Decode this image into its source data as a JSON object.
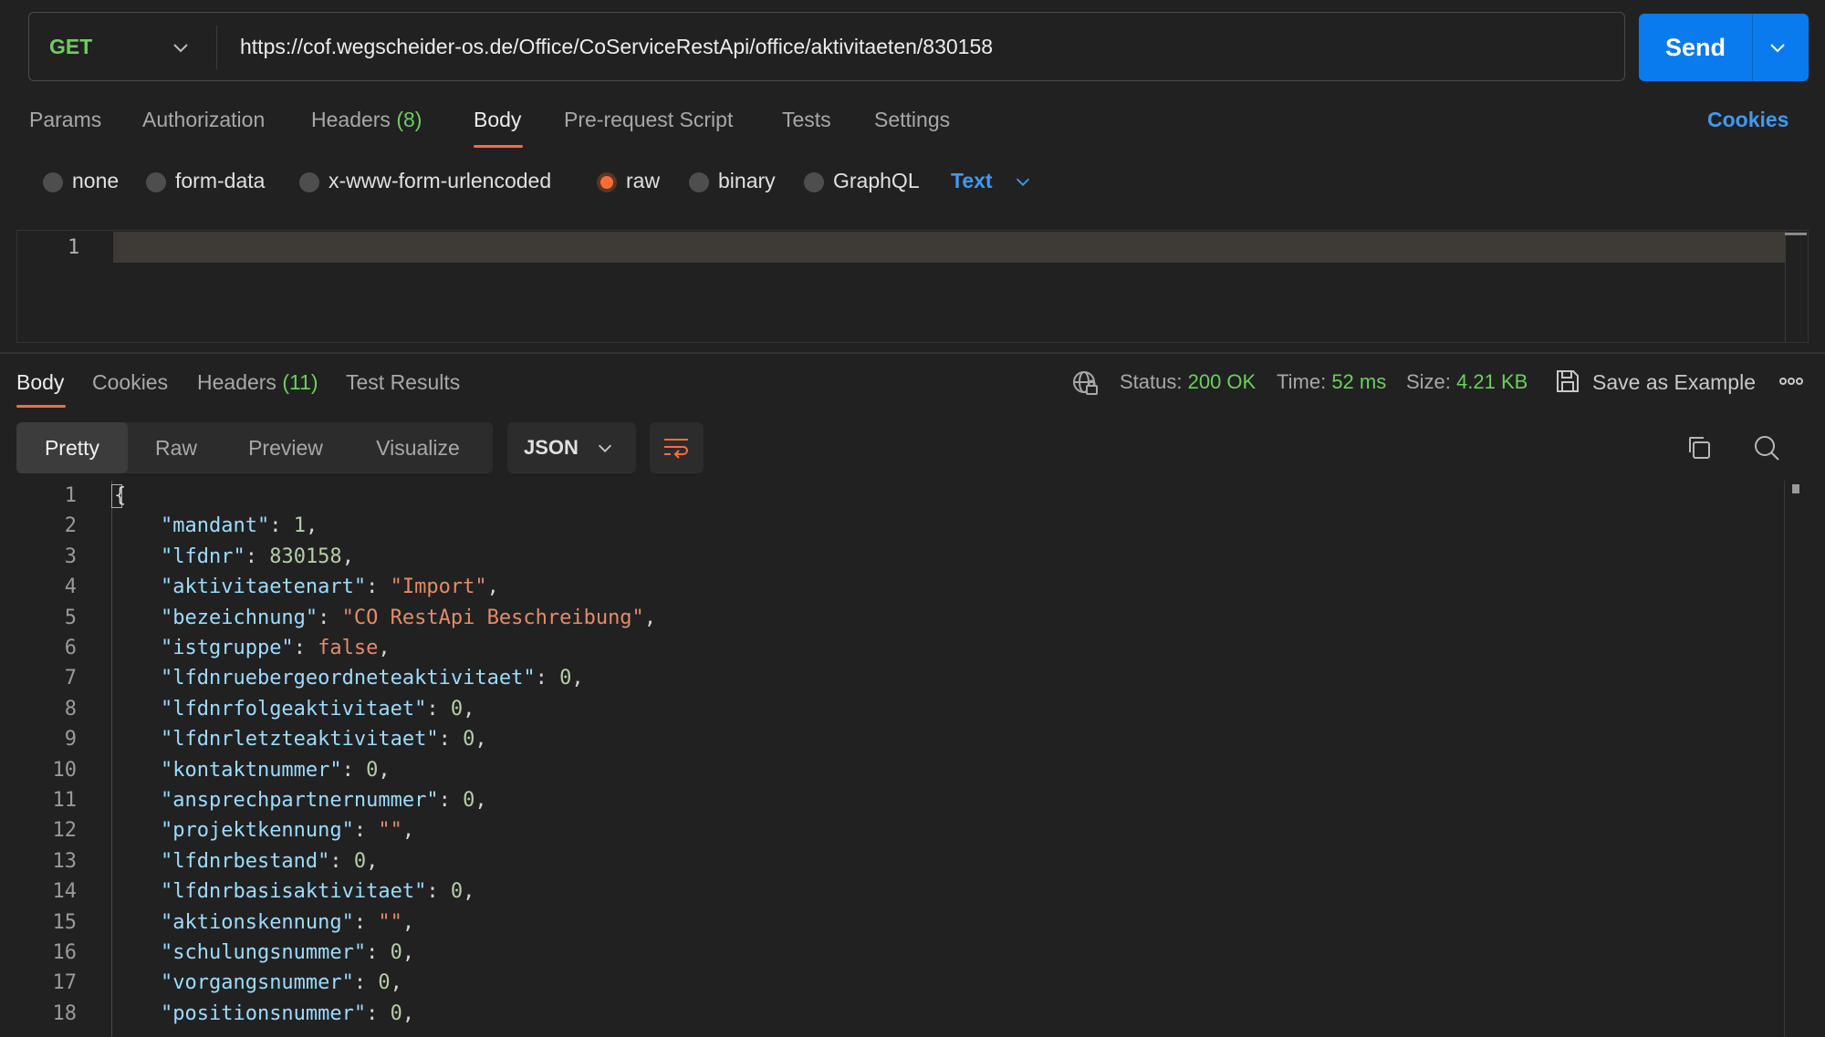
{
  "request": {
    "method": "GET",
    "url": "https://cof.wegscheider-os.de/Office/CoServiceRestApi/office/aktivitaeten/830158",
    "send_label": "Send"
  },
  "request_tabs": {
    "params": "Params",
    "authorization": "Authorization",
    "headers": "Headers",
    "headers_count": "(8)",
    "body": "Body",
    "pre_request_script": "Pre-request Script",
    "tests": "Tests",
    "settings": "Settings",
    "cookies": "Cookies"
  },
  "body_types": {
    "none": "none",
    "form_data": "form-data",
    "urlencoded": "x-www-form-urlencoded",
    "raw": "raw",
    "binary": "binary",
    "graphql": "GraphQL",
    "selected": "raw",
    "raw_format": "Text"
  },
  "request_editor": {
    "line_number": "1"
  },
  "response_tabs": {
    "body": "Body",
    "cookies": "Cookies",
    "headers": "Headers",
    "headers_count": "(11)",
    "test_results": "Test Results"
  },
  "response_meta": {
    "status_label": "Status:",
    "status_value": "200 OK",
    "time_label": "Time:",
    "time_value": "52 ms",
    "size_label": "Size:",
    "size_value": "4.21 KB",
    "save_as_example": "Save as Example"
  },
  "view_modes": {
    "pretty": "Pretty",
    "raw": "Raw",
    "preview": "Preview",
    "visualize": "Visualize",
    "format": "JSON"
  },
  "response_body": {
    "lines": [
      {
        "n": "1",
        "open": "{"
      },
      {
        "n": "2",
        "key": "\"mandant\"",
        "value": "1",
        "type": "num"
      },
      {
        "n": "3",
        "key": "\"lfdnr\"",
        "value": "830158",
        "type": "num"
      },
      {
        "n": "4",
        "key": "\"aktivitaetenart\"",
        "value": "\"Import\"",
        "type": "str"
      },
      {
        "n": "5",
        "key": "\"bezeichnung\"",
        "value": "\"CO RestApi Beschreibung\"",
        "type": "str"
      },
      {
        "n": "6",
        "key": "\"istgruppe\"",
        "value": "false",
        "type": "bool"
      },
      {
        "n": "7",
        "key": "\"lfdnruebergeordneteaktivitaet\"",
        "value": "0",
        "type": "num"
      },
      {
        "n": "8",
        "key": "\"lfdnrfolgeaktivitaet\"",
        "value": "0",
        "type": "num"
      },
      {
        "n": "9",
        "key": "\"lfdnrletzteaktivitaet\"",
        "value": "0",
        "type": "num"
      },
      {
        "n": "10",
        "key": "\"kontaktnummer\"",
        "value": "0",
        "type": "num"
      },
      {
        "n": "11",
        "key": "\"ansprechpartnernummer\"",
        "value": "0",
        "type": "num"
      },
      {
        "n": "12",
        "key": "\"projektkennung\"",
        "value": "\"\"",
        "type": "str"
      },
      {
        "n": "13",
        "key": "\"lfdnrbestand\"",
        "value": "0",
        "type": "num"
      },
      {
        "n": "14",
        "key": "\"lfdnrbasisaktivitaet\"",
        "value": "0",
        "type": "num"
      },
      {
        "n": "15",
        "key": "\"aktionskennung\"",
        "value": "\"\"",
        "type": "str"
      },
      {
        "n": "16",
        "key": "\"schulungsnummer\"",
        "value": "0",
        "type": "num"
      },
      {
        "n": "17",
        "key": "\"vorgangsnummer\"",
        "value": "0",
        "type": "num"
      },
      {
        "n": "18",
        "key": "\"positionsnummer\"",
        "value": "0",
        "type": "num"
      }
    ]
  },
  "colors": {
    "accent": "#ff6c37",
    "send": "#097bed",
    "link": "#3e9af0",
    "success": "#6ccf5a",
    "background": "#212121"
  },
  "icons": {
    "method_dropdown": "chevron-down-icon",
    "send_dropdown": "chevron-down-icon",
    "network": "globe-lock-icon",
    "save": "save-icon",
    "more": "more-horizontal-icon",
    "wrap": "wrap-lines-icon",
    "copy": "copy-icon",
    "search": "search-icon"
  }
}
